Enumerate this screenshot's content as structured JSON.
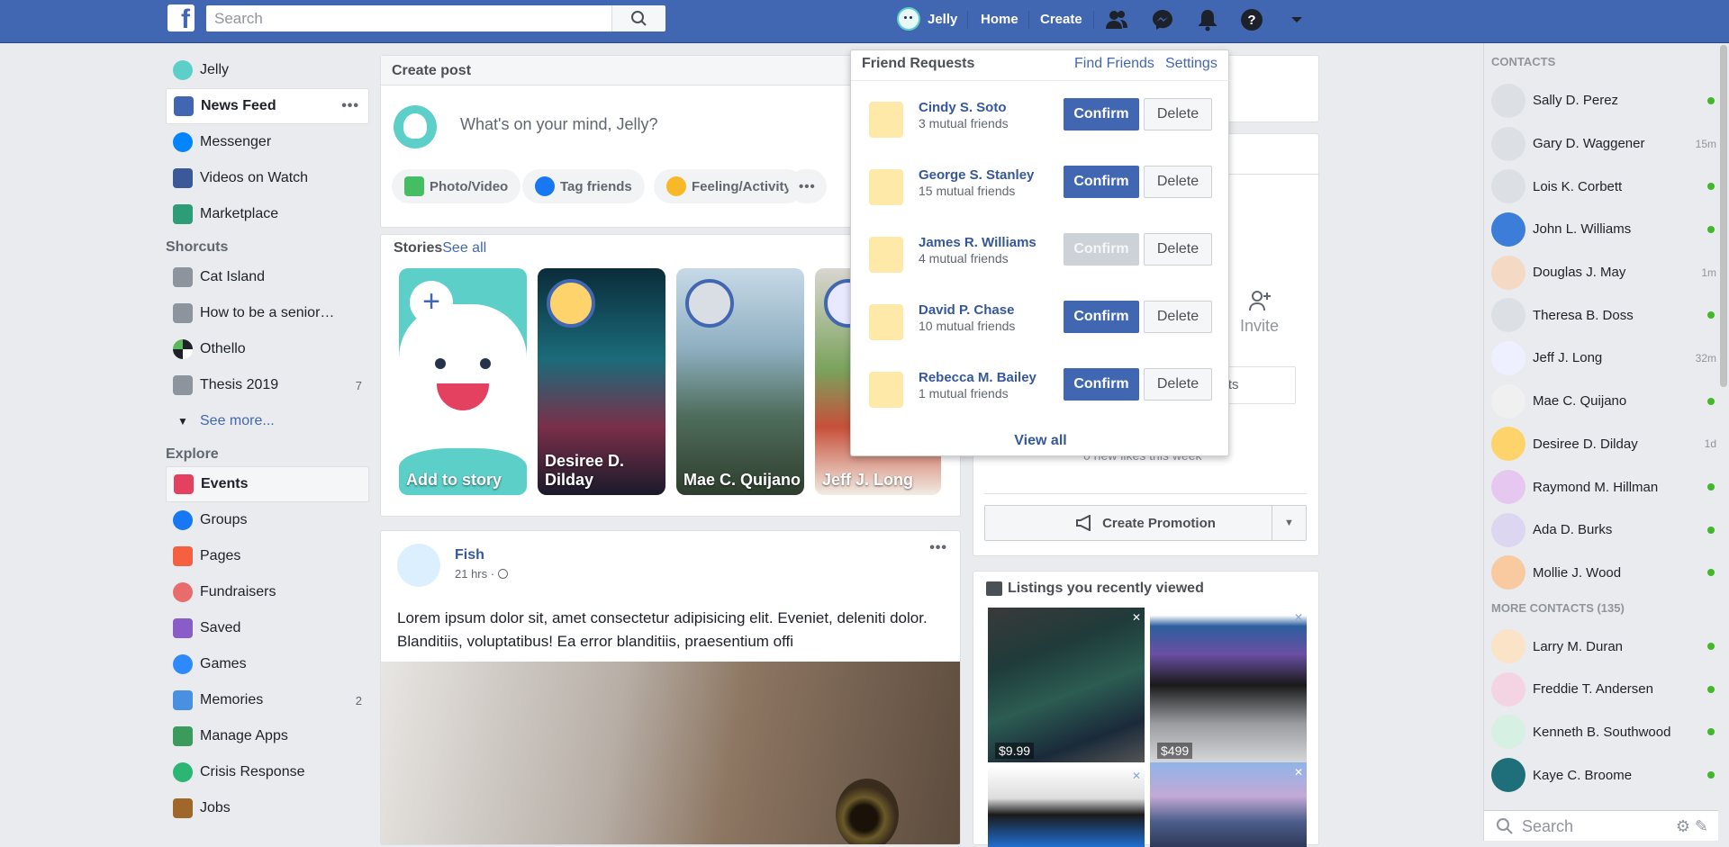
{
  "topbar": {
    "logo": "f",
    "search_placeholder": "Search",
    "user_name": "Jelly",
    "home": "Home",
    "create": "Create"
  },
  "sidebar": {
    "profile": "Jelly",
    "main": [
      {
        "label": "News Feed",
        "icon": "news-feed-icon",
        "color": "#4267b2"
      },
      {
        "label": "Messenger",
        "icon": "messenger-icon",
        "color": "#0084ff"
      },
      {
        "label": "Videos on Watch",
        "icon": "watch-icon",
        "color": "#3b5998"
      },
      {
        "label": "Marketplace",
        "icon": "marketplace-icon",
        "color": "#2d9d78"
      }
    ],
    "shortcuts_title": "Shorcuts",
    "shortcuts": [
      {
        "label": "Cat Island",
        "count": ""
      },
      {
        "label": "How to be a senior…",
        "count": ""
      },
      {
        "label": "Othello",
        "count": ""
      },
      {
        "label": "Thesis 2019",
        "count": "7"
      }
    ],
    "see_more": "See more...",
    "explore_title": "Explore",
    "explore": [
      {
        "label": "Events",
        "count": "",
        "color": "#e4405f"
      },
      {
        "label": "Groups",
        "count": "",
        "color": "#1877f2"
      },
      {
        "label": "Pages",
        "count": "",
        "color": "#f56040"
      },
      {
        "label": "Fundraisers",
        "count": "",
        "color": "#e86c6c"
      },
      {
        "label": "Saved",
        "count": "",
        "color": "#8a5cc7"
      },
      {
        "label": "Games",
        "count": "",
        "color": "#2e89ff"
      },
      {
        "label": "Memories",
        "count": "2",
        "color": "#4a90e2"
      },
      {
        "label": "Manage Apps",
        "count": "",
        "color": "#3a9b5c"
      },
      {
        "label": "Crisis Response",
        "count": "",
        "color": "#2bb673"
      },
      {
        "label": "Jobs",
        "count": "",
        "color": "#a0672b"
      }
    ]
  },
  "composer": {
    "title": "Create post",
    "placeholder": "What's on your mind, Jelly?",
    "actions": [
      "Photo/Video",
      "Tag friends",
      "Feeling/Activity"
    ]
  },
  "stories": {
    "title": "Stories",
    "see_all": "See all",
    "items": [
      "Add to story",
      "Desiree D. Dilday",
      "Mae C. Quijano",
      "Jeff J. Long"
    ]
  },
  "post": {
    "author": "Fish",
    "time": "21 hrs ·",
    "body": "Lorem ipsum dolor sit, amet consectetur adipisicing elit. Eveniet, deleniti dolor. Blanditiis, voluptatibus! Ea error blanditiis, praesentium offi"
  },
  "page_panel": {
    "invite": "Invite",
    "posts": "Posts",
    "new_likes": "0 new likes this week",
    "promotion": "Create Promotion"
  },
  "listings": {
    "title": "Listings you recently viewed",
    "items": [
      {
        "price": "$9.99"
      },
      {
        "price": "$499"
      }
    ]
  },
  "friend_requests": {
    "title": "Friend Requests",
    "find_friends": "Find Friends",
    "settings": "Settings",
    "confirm": "Confirm",
    "delete": "Delete",
    "view_all": "View all",
    "requests": [
      {
        "name": "Cindy S. Soto",
        "mutual": "3 mutual friends",
        "disabled": false
      },
      {
        "name": "George S. Stanley",
        "mutual": "15 mutual friends",
        "disabled": false
      },
      {
        "name": "James R. Williams",
        "mutual": "4 mutual friends",
        "disabled": true
      },
      {
        "name": "David P. Chase",
        "mutual": "10 mutual friends",
        "disabled": false
      },
      {
        "name": "Rebecca M. Bailey",
        "mutual": "1 mutual friends",
        "disabled": false
      }
    ]
  },
  "contacts": {
    "title": "CONTACTS",
    "list": [
      {
        "name": "Sally D. Perez",
        "status": ""
      },
      {
        "name": "Gary D. Waggener",
        "status": "15m"
      },
      {
        "name": "Lois K. Corbett",
        "status": ""
      },
      {
        "name": "John L. Williams",
        "status": ""
      },
      {
        "name": "Douglas J. May",
        "status": "1m"
      },
      {
        "name": "Theresa B. Doss",
        "status": ""
      },
      {
        "name": "Jeff J. Long",
        "status": "32m"
      },
      {
        "name": "Mae C. Quijano",
        "status": ""
      },
      {
        "name": "Desiree D. Dilday",
        "status": "1d"
      },
      {
        "name": "Raymond M. Hillman",
        "status": ""
      },
      {
        "name": "Ada D. Burks",
        "status": ""
      },
      {
        "name": "Mollie J. Wood",
        "status": ""
      }
    ],
    "more_title": "MORE CONTACTS (135)",
    "more": [
      {
        "name": "Larry M. Duran"
      },
      {
        "name": "Freddie T. Andersen"
      },
      {
        "name": "Kenneth B. Southwood"
      },
      {
        "name": "Kaye C. Broome"
      }
    ],
    "search_placeholder": "Search"
  }
}
